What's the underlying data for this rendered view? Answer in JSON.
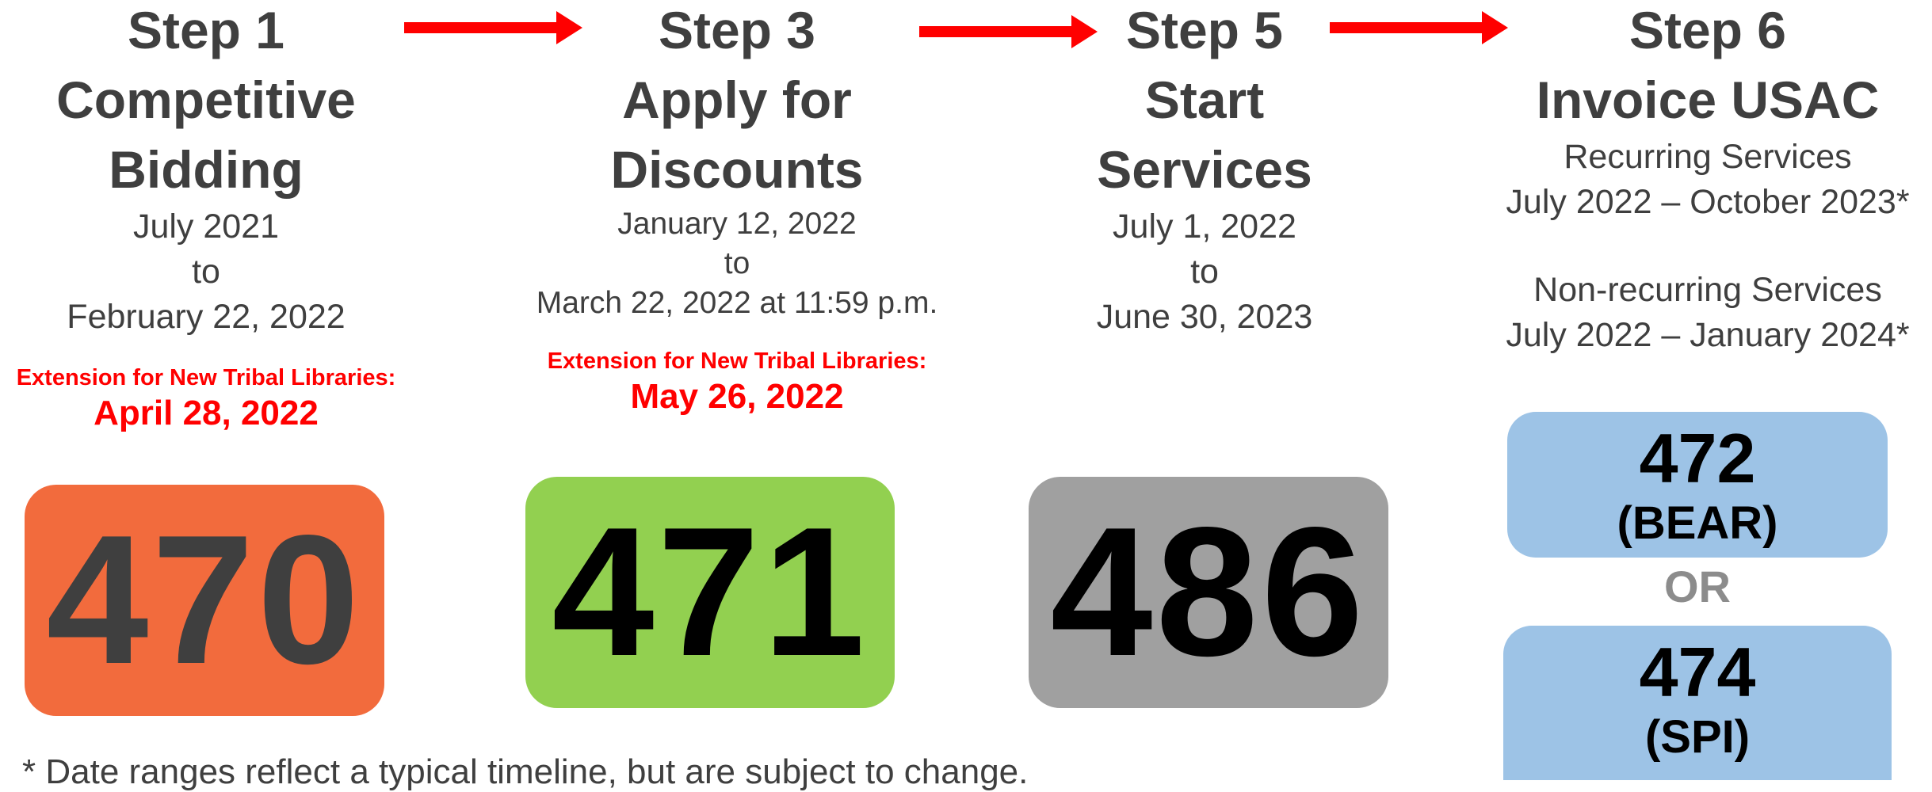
{
  "steps": [
    {
      "title": "Step 1",
      "subtitle_lines": [
        "Competitive",
        "Bidding"
      ],
      "dates": [
        "July 2021",
        "to",
        "February 22, 2022"
      ],
      "extension_label": "Extension for New Tribal Libraries:",
      "extension_date": "April 28, 2022",
      "form": "470",
      "color": "#f26b3d",
      "text_color": "#3f3f3f"
    },
    {
      "title": "Step 3",
      "subtitle_lines": [
        "Apply for",
        "Discounts"
      ],
      "dates": [
        "January 12, 2022",
        "to",
        "March 22, 2022 at 11:59 p.m."
      ],
      "extension_label": "Extension for New Tribal Libraries:",
      "extension_date": "May 26, 2022",
      "form": "471",
      "color": "#92d050",
      "text_color": "#000000"
    },
    {
      "title": "Step 5",
      "subtitle_lines": [
        "Start",
        "Services"
      ],
      "dates": [
        "July 1, 2022",
        "to",
        "June 30, 2023"
      ],
      "form": "486",
      "color": "#a0a0a0",
      "text_color": "#000000"
    },
    {
      "title": "Step 6",
      "subtitle_lines": [
        "Invoice USAC"
      ],
      "recurring_label": "Recurring Services",
      "recurring_range": "July 2022 – October 2023*",
      "nonrecurring_label": "Non-recurring Services",
      "nonrecurring_range": "July 2022 – January 2024*",
      "option_a": {
        "form": "472",
        "name": "(BEAR)"
      },
      "or_label": "OR",
      "option_b": {
        "form": "474",
        "name": "(SPI)"
      },
      "color": "#9dc3e6"
    }
  ],
  "arrow_color": "#ff0000",
  "footnote": "* Date ranges reflect a typical timeline, but are subject to change."
}
